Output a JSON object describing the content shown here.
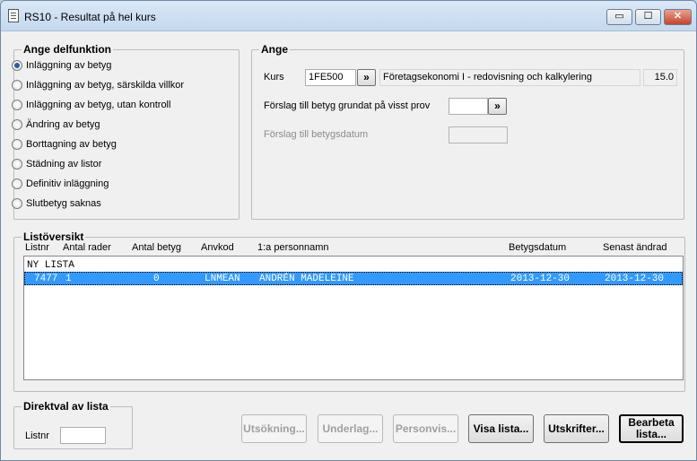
{
  "window": {
    "title": "RS10 - Resultat på hel kurs",
    "controls": {
      "minimize": "▭",
      "maximize": "☐",
      "close": "✕"
    }
  },
  "delfunktion": {
    "legend": "Ange delfunktion",
    "options": [
      {
        "label": "Inläggning av betyg",
        "checked": true
      },
      {
        "label": "Inläggning av betyg, särskilda villkor",
        "checked": false
      },
      {
        "label": "Inläggning av betyg, utan kontroll",
        "checked": false
      },
      {
        "label": "Ändring av betyg",
        "checked": false
      },
      {
        "label": "Borttagning av betyg",
        "checked": false
      },
      {
        "label": "Städning av listor",
        "checked": false
      },
      {
        "label": "Definitiv inläggning",
        "checked": false
      },
      {
        "label": "Slutbetyg saknas",
        "checked": false
      }
    ]
  },
  "ange": {
    "legend": "Ange",
    "kurs_label": "Kurs",
    "kurs_code": "1FE500",
    "lookup_glyph": "»",
    "kurs_name": "Företagsekonomi I - redovisning och kalkylering",
    "kurs_points": "15.0",
    "forslag_prov_label": "Förslag till betyg grundat på visst prov",
    "forslag_prov_value": "",
    "forslag_datum_label": "Förslag till betygsdatum",
    "forslag_datum_value": ""
  },
  "listoversikt": {
    "legend": "Listöversikt",
    "columns": [
      "Listnr",
      "Antal rader",
      "Antal betyg",
      "Anvkod",
      "1:a personnamn",
      "Betygsdatum",
      "Senast ändrad"
    ],
    "new_list_label": "NY LISTA",
    "rows": [
      {
        "listnr": "7477",
        "antal_rader": "1",
        "antal_betyg": "0",
        "anvkod": "LNMEAN",
        "personnamn": "ANDRÉN MADELEINE",
        "betygsdatum": "2013-12-30",
        "senast_andrad": "2013-12-30"
      }
    ]
  },
  "direktval": {
    "legend": "Direktval av lista",
    "listnr_label": "Listnr",
    "listnr_value": ""
  },
  "buttons": {
    "utsokning": "Utsökning...",
    "underlag": "Underlag...",
    "personvis": "Personvis...",
    "visa_lista": "Visa lista...",
    "utskrifter": "Utskrifter...",
    "bearbeta_line1": "Bearbeta",
    "bearbeta_line2": "lista..."
  }
}
